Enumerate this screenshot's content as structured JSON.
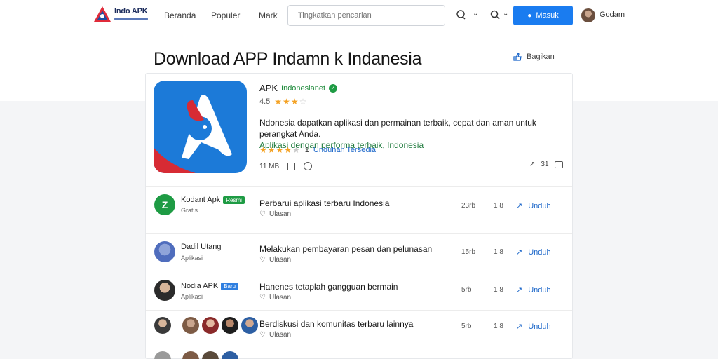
{
  "header": {
    "logo_text": "Indo APK",
    "nav": [
      "Beranda",
      "Populer",
      "Mark"
    ],
    "search_placeholder": "Tingkatkan pencarian",
    "primary_button": "Masuk",
    "user_name": "Godam"
  },
  "hero": {
    "title": "Download APP Indamn k Indanesia",
    "share_label": "Bagikan"
  },
  "app": {
    "name": "APK",
    "publisher": "Indonesianet",
    "rating_text": "4.5",
    "description_main": "Ndonesia dapatkan aplikasi dan permainan terbaik, cepat dan aman untuk perangkat Anda.",
    "description_highlight": "Aplikasi dengan performa terbaik, Indonesia",
    "meta_count": "1",
    "meta_link": "Unduhan Tersedia",
    "info_size": "11 MB",
    "action_count": "31"
  },
  "rows": [
    {
      "title": "Kodant Apk",
      "badge": "Resmi",
      "badge_color": "#1e9b44",
      "sub": "Gratis",
      "text": "Perbarui aplikasi terbaru Indonesia",
      "meta": "Ulasan",
      "count1": "23rb",
      "count2": "1 8",
      "action": "Unduh"
    },
    {
      "title": "Dadil Utang",
      "badge": "",
      "badge_color": "",
      "sub": "Aplikasi",
      "text": "Melakukan pembayaran pesan dan pelunasan",
      "meta": "Ulasan",
      "count1": "15rb",
      "count2": "1 8",
      "action": "Unduh"
    },
    {
      "title": "Nodia APK",
      "badge": "Baru",
      "badge_color": "#2f7fe0",
      "sub": "Aplikasi",
      "text": "Hanenes tetaplah gangguan bermain",
      "meta": "Ulasan",
      "count1": "5rb",
      "count2": "1 8",
      "action": "Unduh"
    },
    {
      "title": "",
      "badge": "",
      "badge_color": "",
      "sub": "",
      "text": "Berdiskusi dan komunitas terbaru lainnya",
      "meta": "Ulasan",
      "count1": "5rb",
      "count2": "1 8",
      "action": "Unduh"
    }
  ],
  "colors": {
    "accent": "#1a7cf0",
    "link": "#1b66c9",
    "verified": "#1e9b44",
    "star": "#f4a224"
  }
}
